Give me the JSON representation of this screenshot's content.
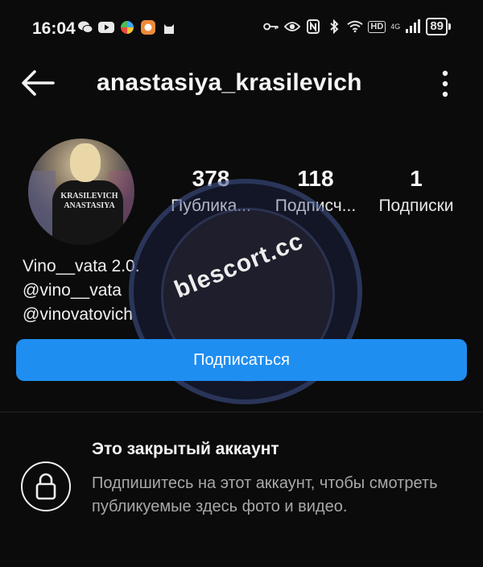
{
  "status_bar": {
    "time": "16:04",
    "network_badge": "HD",
    "network_gen": "4G",
    "battery": "89"
  },
  "header": {
    "username": "anastasiya_krasilevich"
  },
  "avatar": {
    "shirt_text_line1": "KRASILEVICH",
    "shirt_text_line2": "ANASTASIYA"
  },
  "stats": {
    "posts_count": "378",
    "posts_label": "Публика...",
    "followers_count": "118",
    "followers_label": "Подписч...",
    "following_count": "1",
    "following_label": "Подписки"
  },
  "bio": {
    "name": "Vino__vata 2.0.",
    "line2": "@vino__vata",
    "line3": "@vinovatovich"
  },
  "follow_button": {
    "label": "Подписаться",
    "color": "#1f8ef1"
  },
  "private_account": {
    "title": "Это закрытый аккаунт",
    "description": "Подпишитесь на этот аккаунт, чтобы смотреть публикуемые здесь фото и видео."
  },
  "watermark": {
    "text": "blescort.cc"
  },
  "colors": {
    "background": "#0b0b0b",
    "accent": "#1f8ef1",
    "secondary_text": "#a8a8a8"
  }
}
